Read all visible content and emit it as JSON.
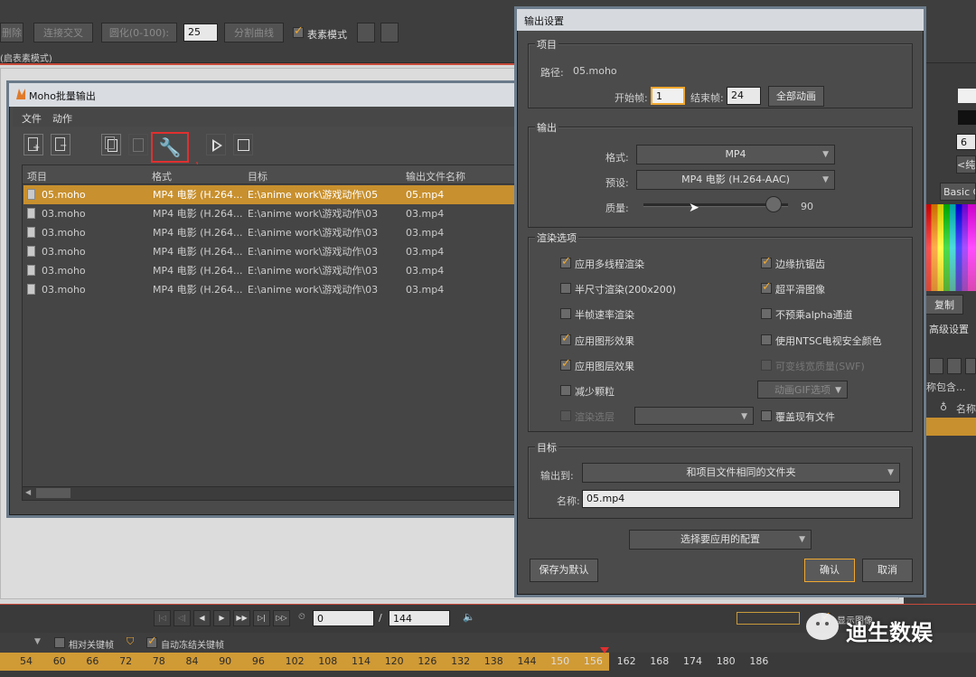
{
  "top_toolbar": {
    "btn_left": "删除",
    "btn_connect": "连接交叉",
    "btn_smooth": "圆化(0-100):",
    "smooth_value": "25",
    "btn_split": "分割曲线",
    "pixel_mode_label": "表素模式",
    "sub_label": "(启表素模式)"
  },
  "batch_window": {
    "title": "Moho批量输出",
    "menu": [
      "文件",
      "动作"
    ],
    "settings_annotation": "设置",
    "columns": [
      "项目",
      "格式",
      "目标",
      "输出文件名称"
    ],
    "rows": [
      {
        "project": "05.moho",
        "format": "MP4 电影 (H.264...",
        "target": "E:\\anime work\\游戏动作\\05",
        "output": "05.mp4",
        "selected": true
      },
      {
        "project": "03.moho",
        "format": "MP4 电影 (H.264...",
        "target": "E:\\anime work\\游戏动作\\03",
        "output": "03.mp4",
        "selected": false
      },
      {
        "project": "03.moho",
        "format": "MP4 电影 (H.264...",
        "target": "E:\\anime work\\游戏动作\\03",
        "output": "03.mp4",
        "selected": false
      },
      {
        "project": "03.moho",
        "format": "MP4 电影 (H.264...",
        "target": "E:\\anime work\\游戏动作\\03",
        "output": "03.mp4",
        "selected": false
      },
      {
        "project": "03.moho",
        "format": "MP4 电影 (H.264...",
        "target": "E:\\anime work\\游戏动作\\03",
        "output": "03.mp4",
        "selected": false
      },
      {
        "project": "03.moho",
        "format": "MP4 电影 (H.264...",
        "target": "E:\\anime work\\游戏动作\\03",
        "output": "03.mp4",
        "selected": false
      }
    ]
  },
  "export_dialog": {
    "title": "输出设置",
    "project_group": "项目",
    "path_label": "路径:",
    "path_value": "05.moho",
    "start_label": "开始帧:",
    "start_value": "1",
    "end_label": "结束帧:",
    "end_value": "24",
    "all_anim_btn": "全部动画",
    "output_group": "输出",
    "format_label": "格式:",
    "format_value": "MP4",
    "preset_label": "预设:",
    "preset_value": "MP4 电影 (H.264-AAC)",
    "quality_label": "质量:",
    "quality_value": "90",
    "quality_fraction": 0.9,
    "render_group": "渲染选项",
    "render_options_left": [
      {
        "label": "应用多线程渲染",
        "checked": true,
        "enabled": true
      },
      {
        "label": "半尺寸渲染(200x200)",
        "checked": false,
        "enabled": true
      },
      {
        "label": "半帧速率渲染",
        "checked": false,
        "enabled": true
      },
      {
        "label": "应用图形效果",
        "checked": true,
        "enabled": true
      },
      {
        "label": "应用图层效果",
        "checked": true,
        "enabled": true
      },
      {
        "label": "减少颗粒",
        "checked": false,
        "enabled": true
      },
      {
        "label": "渲染选层",
        "checked": false,
        "enabled": false
      }
    ],
    "render_options_right": [
      {
        "label": "边缘抗锯齿",
        "checked": true,
        "enabled": true
      },
      {
        "label": "超平滑图像",
        "checked": true,
        "enabled": true
      },
      {
        "label": "不预乘alpha通道",
        "checked": false,
        "enabled": true
      },
      {
        "label": "使用NTSC电视安全颜色",
        "checked": false,
        "enabled": true
      },
      {
        "label": "可变线宽质量(SWF)",
        "checked": false,
        "enabled": false
      },
      {
        "label": "覆盖现有文件",
        "checked": false,
        "enabled": true
      }
    ],
    "gif_options": "动画GIF选项",
    "target_group": "目标",
    "output_to_label": "输出到:",
    "output_to_value": "和项目文件相同的文件夹",
    "name_label": "名称:",
    "name_value": "05.mp4",
    "preset_select": "选择要应用的配置",
    "save_default_btn": "保存为默认",
    "ok_btn": "确认",
    "cancel_btn": "取消"
  },
  "right_panel": {
    "dropdown": "Basic C",
    "copy_btn": "复制",
    "advanced": "高级设置",
    "name_col": "名称",
    "list_text": "称包含...",
    "value_6": "6",
    "text_chun": "<纯"
  },
  "timeline": {
    "frame_value": "0",
    "total_frames": "144",
    "relative_keys": "相对关键帧",
    "auto_freeze": "自动冻结关键帧",
    "show_image": "显示图像",
    "ticks": [
      "54",
      "60",
      "66",
      "72",
      "78",
      "84",
      "90",
      "96",
      "102",
      "108",
      "114",
      "120",
      "126",
      "132",
      "138",
      "144",
      "150",
      "156",
      "162",
      "168",
      "174",
      "180",
      "186"
    ],
    "highlight_end": "144"
  },
  "watermark": "迪生数娱",
  "colors": {
    "accent": "#f0a830",
    "selection": "#c8902e",
    "dialog_bg": "#4b4b4b",
    "timeline_orange": "#d09a35",
    "red_highlight": "#e03030"
  }
}
